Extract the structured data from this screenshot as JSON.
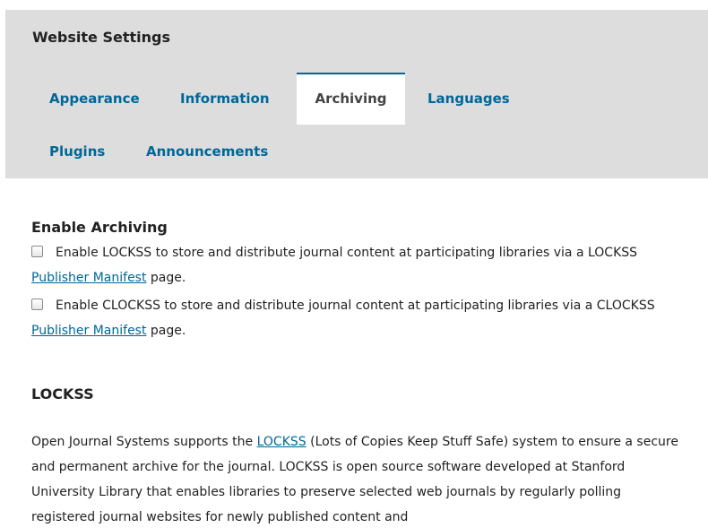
{
  "header": {
    "title": "Website Settings",
    "tabs": [
      {
        "label": "Appearance"
      },
      {
        "label": "Information"
      },
      {
        "label": "Archiving"
      },
      {
        "label": "Languages"
      },
      {
        "label": "Plugins"
      },
      {
        "label": "Announcements"
      }
    ],
    "active_tab": "Archiving"
  },
  "enable_archiving": {
    "heading": "Enable Archiving",
    "lockss_option": {
      "checked": false,
      "text_before": "Enable LOCKSS to store and distribute journal content at participating libraries via a LOCKSS ",
      "link": "Publisher Manifest",
      "text_after": " page."
    },
    "clockss_option": {
      "checked": false,
      "text_before": "Enable CLOCKSS to store and distribute journal content at participating libraries via a CLOCKSS ",
      "link": "Publisher Manifest",
      "text_after": " page."
    }
  },
  "lockss": {
    "heading": "LOCKSS",
    "text_before": "Open Journal Systems supports the ",
    "link": "LOCKSS",
    "text_after": " (Lots of Copies Keep Stuff Safe) system to ensure a secure and permanent archive for the journal. LOCKSS is open source software developed at Stanford University Library that enables libraries to preserve selected web journals by regularly polling registered journal websites for newly published content and"
  },
  "colors": {
    "link": "#006798",
    "header_bg": "#dddddd",
    "text": "#222222"
  }
}
